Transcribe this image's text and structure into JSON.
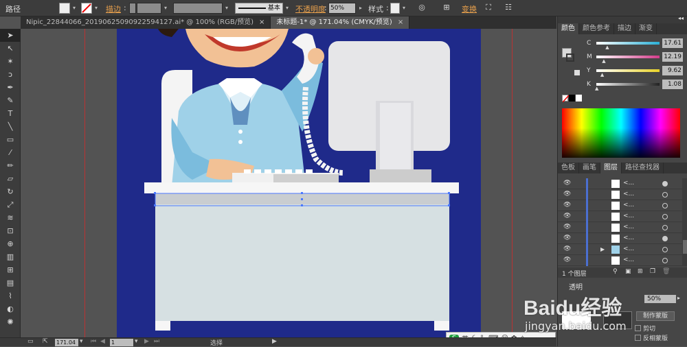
{
  "app": {
    "path_label": "路径",
    "stroke_label": "描边",
    "stroke_profile": "基本",
    "opacity_label": "不透明度",
    "opacity_value": "50%",
    "style_label": "样式",
    "transform_label": "变换"
  },
  "tabs": [
    {
      "label": "Nipic_22844066_20190625090922594127.ai* @ 100% (RGB/预览)",
      "active": false
    },
    {
      "label": "未标题-1* @ 171.04% (CMYK/预览)",
      "active": true
    }
  ],
  "status": {
    "zoom": "171.04",
    "page": "1",
    "tool_label": "选择"
  },
  "color_panel": {
    "tabs": [
      "颜色",
      "颜色参考",
      "描边",
      "渐变"
    ],
    "channels": [
      {
        "label": "C",
        "value": "17.61",
        "color": "#2ab0d6"
      },
      {
        "label": "M",
        "value": "12.19",
        "color": "#d43b8a"
      },
      {
        "label": "Y",
        "value": "9.62",
        "color": "#e8d228"
      },
      {
        "label": "K",
        "value": "1.08",
        "color": "#222222"
      }
    ]
  },
  "layers_panel": {
    "tabs": [
      "色板",
      "画笔",
      "图层",
      "路径查找器"
    ],
    "rows": [
      "<...",
      "<...",
      "<...",
      "<...",
      "<...",
      "<...",
      "<...",
      "<..."
    ],
    "footer": "1 个图层"
  },
  "bottom_panel": {
    "label": "透明",
    "value": "50%",
    "make_mask": "制作蒙版",
    "clip": "剪切",
    "invert_mask": "反相蒙版"
  },
  "ime": {
    "lang": "英"
  },
  "watermark": {
    "text": "Baidu经验",
    "url": "jingyan.baidu.com"
  }
}
